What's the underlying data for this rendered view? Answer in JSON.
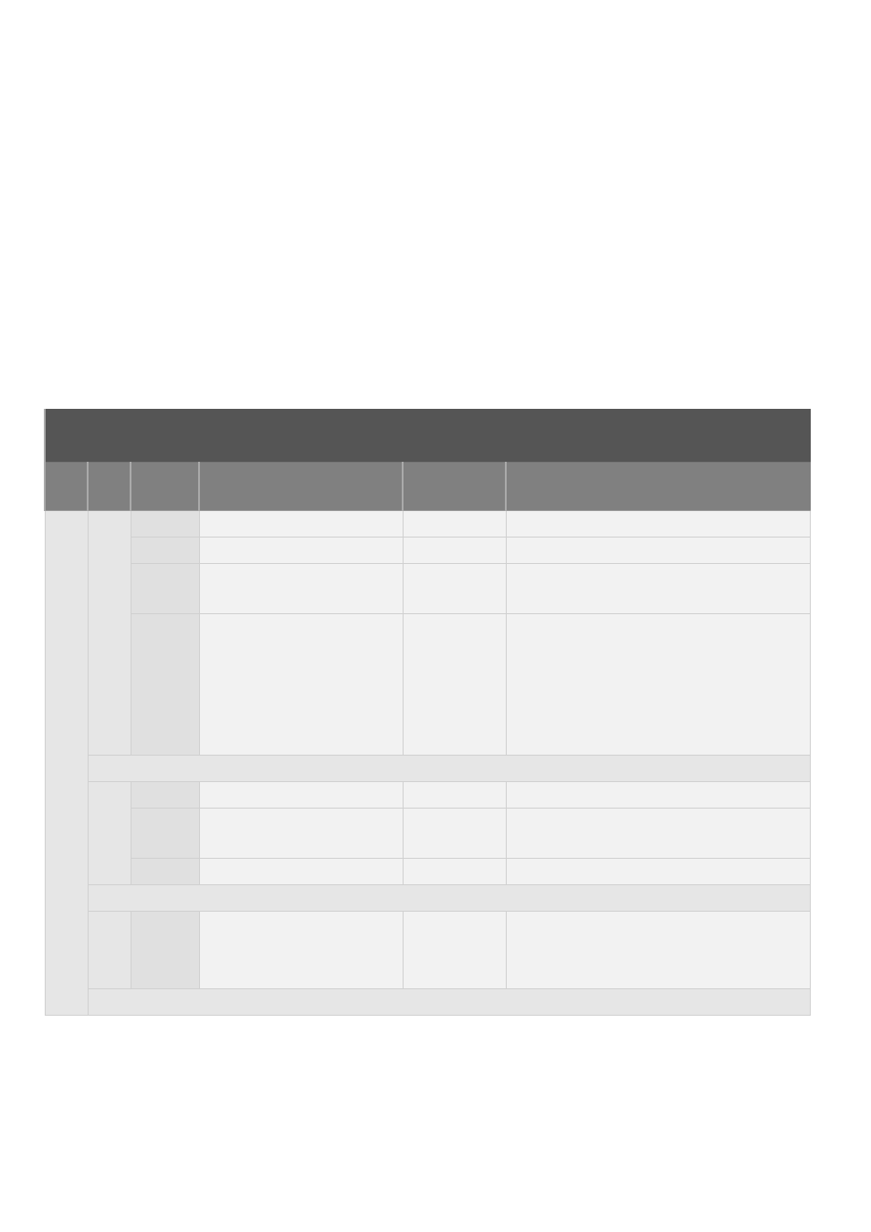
{
  "table": {
    "title": "",
    "headers": [
      "",
      "",
      "",
      "",
      "",
      ""
    ],
    "sections": [
      {
        "group": "",
        "blocks": [
          {
            "sub": "",
            "rows": [
              {
                "label": "",
                "c1": "",
                "c2": "",
                "c3": "",
                "h": "h-small"
              },
              {
                "label": "",
                "c1": "",
                "c2": "",
                "c3": "",
                "h": "h-small"
              },
              {
                "label": "",
                "c1": "",
                "c2": "",
                "c3": "",
                "h": "h-med"
              },
              {
                "label": "",
                "c1": "",
                "c2": "",
                "c3": "",
                "h": "h-big"
              }
            ]
          },
          {
            "sub": "",
            "rows": [
              {
                "label": "",
                "c1": "",
                "c2": "",
                "c3": "",
                "h": "h-small"
              },
              {
                "label": "",
                "c1": "",
                "c2": "",
                "c3": "",
                "h": "h-med"
              },
              {
                "label": "",
                "c1": "",
                "c2": "",
                "c3": "",
                "h": "h-small"
              }
            ]
          },
          {
            "sub": "",
            "rows": [
              {
                "label": "",
                "c1": "",
                "c2": "",
                "c3": "",
                "h": "h-sec"
              }
            ]
          }
        ]
      }
    ]
  }
}
